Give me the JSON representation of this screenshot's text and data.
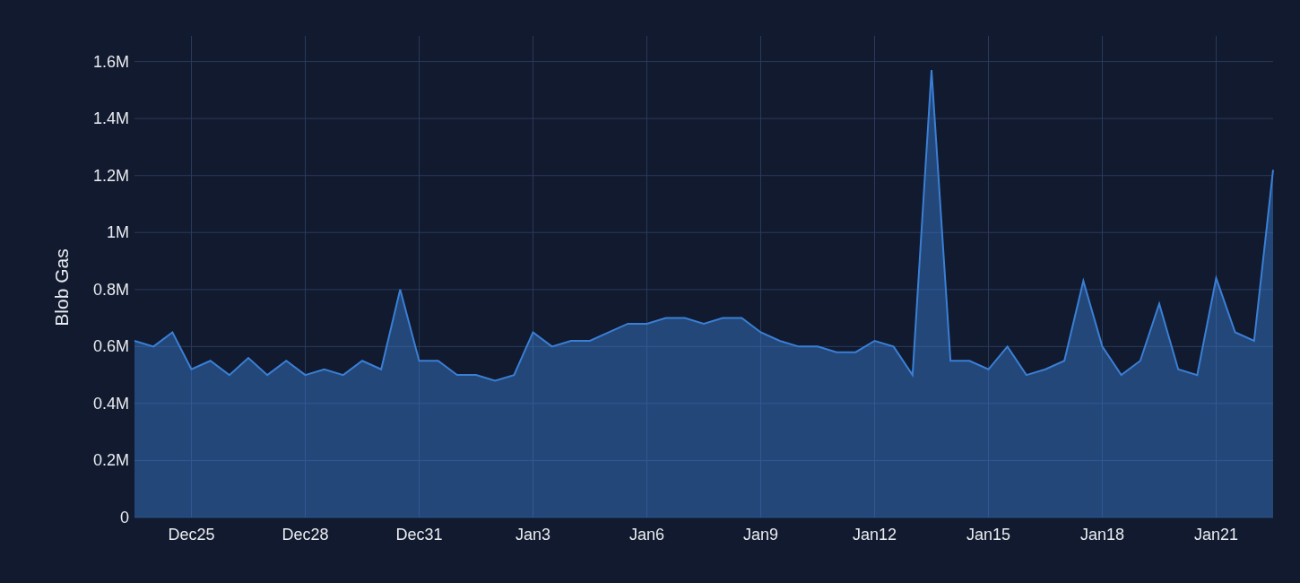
{
  "chart_data": {
    "type": "area",
    "ylabel": "Blob Gas",
    "grid": true,
    "categories": [
      null,
      null,
      null,
      "Dec25",
      null,
      null,
      null,
      null,
      null,
      "Dec28",
      null,
      null,
      null,
      null,
      null,
      "Dec31",
      null,
      null,
      null,
      null,
      null,
      "Jan3",
      null,
      null,
      null,
      null,
      null,
      "Jan6",
      null,
      null,
      null,
      null,
      null,
      "Jan9",
      null,
      null,
      null,
      null,
      null,
      "Jan12",
      null,
      null,
      null,
      null,
      null,
      "Jan15",
      null,
      null,
      null,
      null,
      null,
      "Jan18",
      null,
      null,
      null,
      null,
      null,
      "Jan21",
      null,
      null,
      null
    ],
    "series": [
      {
        "color": "#3a7fd5",
        "values": [
          0.62,
          0.6,
          0.65,
          0.52,
          0.55,
          0.5,
          0.56,
          0.5,
          0.55,
          0.5,
          0.52,
          0.5,
          0.55,
          0.52,
          0.8,
          0.55,
          0.55,
          0.5,
          0.5,
          0.48,
          0.5,
          0.65,
          0.6,
          0.62,
          0.62,
          0.65,
          0.68,
          0.68,
          0.7,
          0.7,
          0.68,
          0.7,
          0.7,
          0.65,
          0.62,
          0.6,
          0.6,
          0.58,
          0.58,
          0.62,
          0.6,
          0.5,
          1.57,
          0.55,
          0.55,
          0.52,
          0.6,
          0.5,
          0.52,
          0.55,
          0.83,
          0.6,
          0.5,
          0.55,
          0.75,
          0.52,
          0.5,
          0.84,
          0.65,
          0.62,
          1.22
        ]
      }
    ],
    "ylim": [
      0,
      1.69
    ],
    "yticks": [
      {
        "value": 0,
        "label": "0"
      },
      {
        "value": 0.2,
        "label": "0.2M"
      },
      {
        "value": 0.4,
        "label": "0.4M"
      },
      {
        "value": 0.6,
        "label": "0.6M"
      },
      {
        "value": 0.8,
        "label": "0.8M"
      },
      {
        "value": 1,
        "label": "1M"
      },
      {
        "value": 1.2,
        "label": "1.2M"
      },
      {
        "value": 1.4,
        "label": "1.4M"
      },
      {
        "value": 1.6,
        "label": "1.6M"
      }
    ]
  }
}
